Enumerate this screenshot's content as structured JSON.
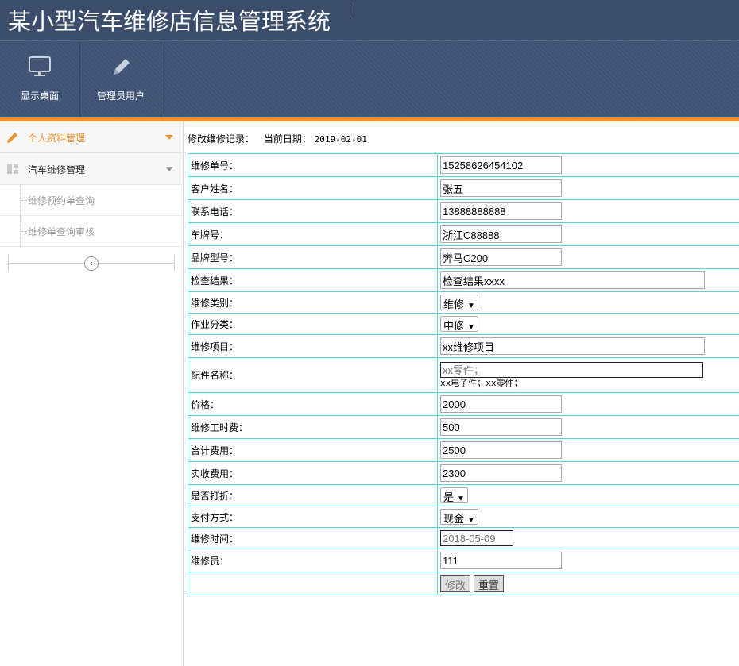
{
  "app": {
    "title": "某小型汽车维修店信息管理系统"
  },
  "nav": [
    {
      "label": "显示桌面",
      "icon": "monitor-icon"
    },
    {
      "label": "管理员用户",
      "icon": "pencil-icon"
    }
  ],
  "sidebar": {
    "items": [
      {
        "label": "个人资料管理",
        "icon": "pencil-icon",
        "active": true
      },
      {
        "label": "汽车维修管理",
        "icon": "grid-icon",
        "active": false
      }
    ],
    "subitems": [
      {
        "label": "维修预约单查询"
      },
      {
        "label": "维修单查询审核"
      }
    ],
    "collapse_glyph": "‹"
  },
  "heading": {
    "title": "修改维修记录：",
    "date_label": "当前日期：",
    "date_value": "2019-02-01"
  },
  "form": {
    "order_no": {
      "label": "维修单号：",
      "value": "15258626454102"
    },
    "customer": {
      "label": "客户姓名：",
      "value": "张五"
    },
    "phone": {
      "label": "联系电话：",
      "value": "13888888888"
    },
    "plate": {
      "label": "车牌号：",
      "value": "浙江C88888"
    },
    "model": {
      "label": "品牌型号：",
      "value": "奔马C200"
    },
    "result": {
      "label": "检查结果：",
      "value": "检查结果xxxx"
    },
    "category": {
      "label": "维修类别：",
      "value": "维修"
    },
    "job_type": {
      "label": "作业分类：",
      "value": "中修"
    },
    "project": {
      "label": "维修项目：",
      "value": "xx维修项目"
    },
    "parts": {
      "label": "配件名称：",
      "placeholder": "xx零件；",
      "hint": "xx电子件；xx零件；"
    },
    "price": {
      "label": "价格：",
      "value": "2000"
    },
    "labor": {
      "label": "维修工时费：",
      "value": "500"
    },
    "total": {
      "label": "合计费用：",
      "value": "2500"
    },
    "received": {
      "label": "实收费用：",
      "value": "2300"
    },
    "discount": {
      "label": "是否打折：",
      "value": "是"
    },
    "payment": {
      "label": "支付方式：",
      "value": "现金"
    },
    "repair_time": {
      "label": "维修时间：",
      "placeholder": "2018-05-09"
    },
    "repairman": {
      "label": "维修员：",
      "value": "111"
    },
    "submit_label": "修改",
    "reset_label": "重置"
  },
  "colors": {
    "header_bg": "#3f5272",
    "accent": "#f0902d",
    "table_border": "#55d2e0"
  }
}
